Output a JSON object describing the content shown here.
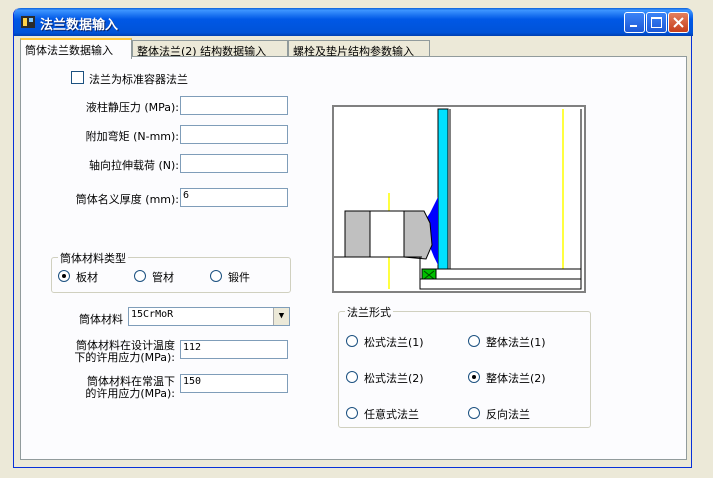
{
  "window": {
    "title": "法兰数据输入"
  },
  "tabs": [
    {
      "label": "筒体法兰数据输入",
      "active": true
    },
    {
      "label": "整体法兰(2) 结构数据输入",
      "active": false
    },
    {
      "label": "螺栓及垫片结构参数输入",
      "active": false
    }
  ],
  "form": {
    "std_flange_checkbox_label": "法兰为标准容器法兰",
    "std_flange_checked": false,
    "static_pressure_label": "液柱静压力 (MPa):",
    "static_pressure_value": "",
    "extra_moment_label": "附加弯矩 (N-mm):",
    "extra_moment_value": "",
    "axial_load_label": "轴向拉伸载荷 (N):",
    "axial_load_value": "",
    "nominal_thickness_label": "筒体名义厚度 (mm):",
    "nominal_thickness_value": "6"
  },
  "material_type_group": {
    "title": "筒体材料类型",
    "options": [
      "板材",
      "管材",
      "锻件"
    ],
    "selected": "板材"
  },
  "material": {
    "label": "筒体材料",
    "value": "15CrMoR",
    "design_stress_label_line1": "筒体材料在设计温度",
    "design_stress_label_line2": "下的许用应力(MPa):",
    "design_stress_value": "112",
    "ambient_stress_label_line1": "筒体材料在常温下",
    "ambient_stress_label_line2": "的许用应力(MPa):",
    "ambient_stress_value": "150"
  },
  "flange_type_group": {
    "title": "法兰形式",
    "options": [
      "松式法兰(1)",
      "整体法兰(1)",
      "松式法兰(2)",
      "整体法兰(2)",
      "任意式法兰",
      "反向法兰"
    ],
    "selected": "整体法兰(2)"
  },
  "colors": {
    "titlebar": "#0058e6",
    "shell_cyan": "#00e0ff",
    "flange_blue": "#0000ff",
    "gasket_green": "#00c000",
    "section_gray": "#c0c0c0",
    "centerline_yellow": "#ffff00"
  }
}
